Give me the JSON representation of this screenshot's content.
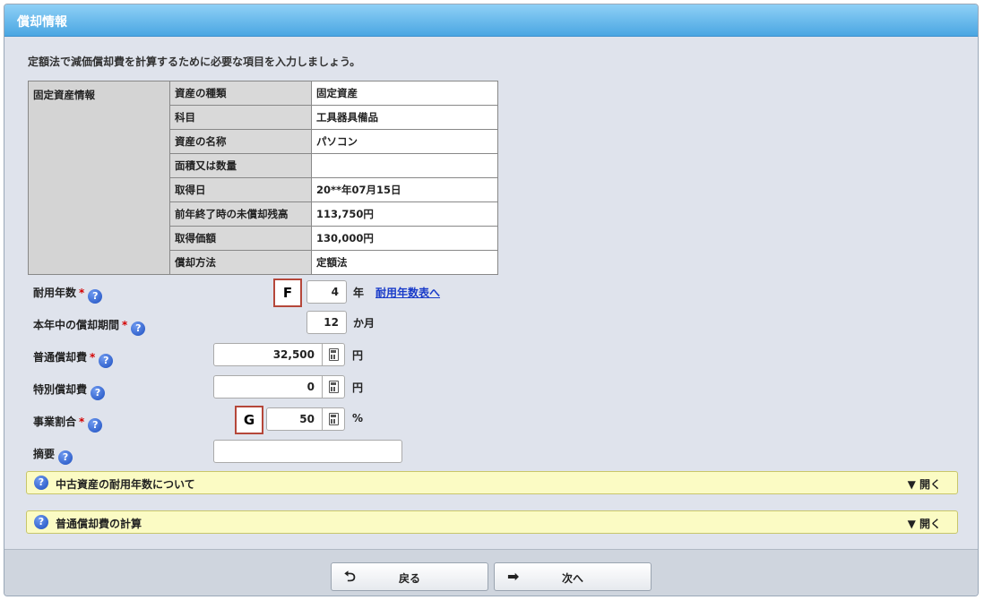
{
  "title": "償却情報",
  "intro": "定額法で減価償却費を計算するために必要な項目を入力しましょう。",
  "asset_table": {
    "header": "固定資産情報",
    "rows": [
      {
        "label": "資産の種類",
        "value": "固定資産"
      },
      {
        "label": "科目",
        "value": "工具器具備品"
      },
      {
        "label": "資産の名称",
        "value": "パソコン"
      },
      {
        "label": "面積又は数量",
        "value": ""
      },
      {
        "label": "取得日",
        "value": "20**年07月15日"
      },
      {
        "label": "前年終了時の未償却残高",
        "value": "113,750円"
      },
      {
        "label": "取得価額",
        "value": "130,000円"
      },
      {
        "label": "償却方法",
        "value": "定額法"
      }
    ]
  },
  "required_mark": "*",
  "help_icon": "?",
  "fields": {
    "useful_life": {
      "label": "耐用年数",
      "value": "4",
      "unit": "年",
      "link": "耐用年数表へ",
      "marker": "F"
    },
    "period": {
      "label": "本年中の償却期間",
      "value": "12",
      "unit": "か月"
    },
    "normal_dep": {
      "label": "普通償却費",
      "value": "32,500",
      "unit": "円"
    },
    "special_dep": {
      "label": "特別償却費",
      "value": "0",
      "unit": "円"
    },
    "business_ratio": {
      "label": "事業割合",
      "value": "50",
      "unit": "%",
      "marker": "G"
    },
    "remarks": {
      "label": "摘要",
      "value": ""
    }
  },
  "accordions": [
    {
      "title": "中古資産の耐用年数について",
      "toggle": "▼ 開く"
    },
    {
      "title": "普通償却費の計算",
      "toggle": "▼ 開く"
    }
  ],
  "buttons": {
    "back": {
      "label": "戻る",
      "icon": "return-arrow-icon"
    },
    "next": {
      "label": "次へ",
      "icon": "right-arrow-icon"
    }
  },
  "colors": {
    "title_bar": "#4aa6e2",
    "accordion_bg": "#fbfbc4",
    "required": "#d40000",
    "link": "#1a3cc9",
    "marker_border": "#b5473a"
  }
}
